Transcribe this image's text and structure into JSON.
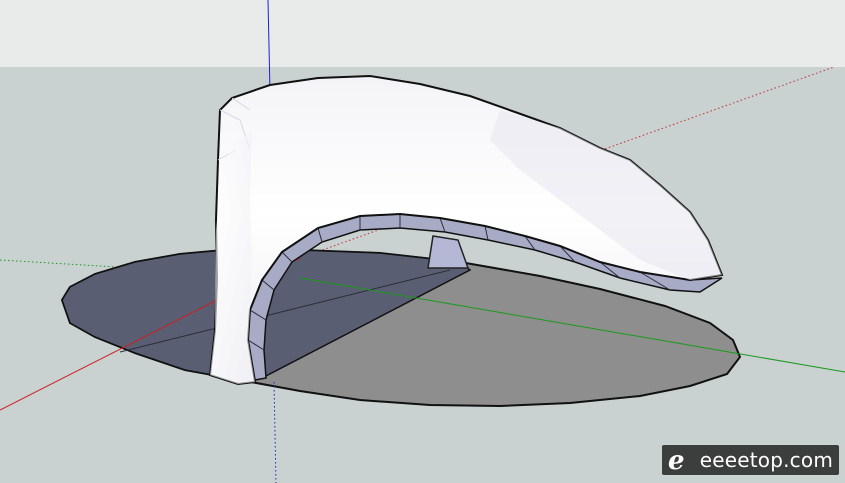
{
  "viewport": {
    "sky_color": "#e9eaea",
    "ground_color": "#c9d1d1",
    "axes": {
      "x_axis_color": "#cc2020",
      "y_axis_color": "#1a9a1a",
      "z_axis_color": "#2020cc"
    }
  },
  "model": {
    "shell_color": "#ffffff",
    "edge_color": "#9a9eb8",
    "pad_shadow_color": "#5a5e72",
    "pad_lit_color": "#8e8e8e",
    "support_color": "#b4b8d4"
  },
  "watermark": {
    "logo_icon": "e-tuo-logo-icon",
    "text": "eeeetop.com"
  }
}
